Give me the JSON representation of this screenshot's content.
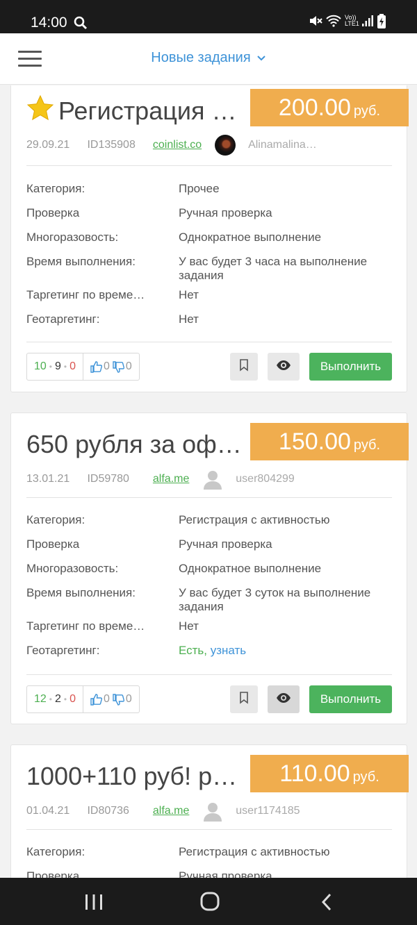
{
  "status_bar": {
    "time": "14:00",
    "network": "Vo)) LTE1"
  },
  "header": {
    "title": "Новые задания"
  },
  "labels": {
    "category": "Категория:",
    "check": "Проверка",
    "multiplicity": "Многоразовость:",
    "duration": "Время выполнения:",
    "time_targeting": "Таргетинг по време…",
    "geo_targeting": "Геотаргетинг:",
    "run_button": "Выполнить",
    "currency": "руб."
  },
  "tasks": [
    {
      "title": "Регистрация …",
      "starred": true,
      "price": "200.00",
      "date": "29.09.21",
      "id": "ID135908",
      "site": "coinlist.co",
      "author": "Alinamalina…",
      "category": "Прочее",
      "check": "Ручная проверка",
      "multiplicity": "Однократное выполнение",
      "duration": "У вас будет 3 часа на выполнение задания",
      "time_targeting": "Нет",
      "geo_targeting": "Нет",
      "stats": {
        "done": "10",
        "pending": "9",
        "rejected": "0",
        "likes": "0",
        "dislikes": "0"
      }
    },
    {
      "title": "650 рубля за оф…",
      "starred": false,
      "price": "150.00",
      "date": "13.01.21",
      "id": "ID59780",
      "site": "alfa.me",
      "author": "user804299",
      "category": "Регистрация с активностью",
      "check": "Ручная проверка",
      "multiplicity": "Однократное выполнение",
      "duration": "У вас будет 3 суток на выполнение задания",
      "time_targeting": "Нет",
      "geo_targeting": "Есть,",
      "geo_targeting_link": "узнать",
      "stats": {
        "done": "12",
        "pending": "2",
        "rejected": "0",
        "likes": "0",
        "dislikes": "0"
      }
    },
    {
      "title": "1000+110 руб! р…",
      "starred": false,
      "price": "110.00",
      "date": "01.04.21",
      "id": "ID80736",
      "site": "alfa.me",
      "author": "user1174185",
      "category": "Регистрация с активностью",
      "check": "Ручная проверка"
    }
  ],
  "colors": {
    "accent": "#3e93d8",
    "price_bg": "#f0ad4e",
    "run_button": "#4cb35d",
    "positive": "#4caf50",
    "negative": "#d9534f"
  }
}
